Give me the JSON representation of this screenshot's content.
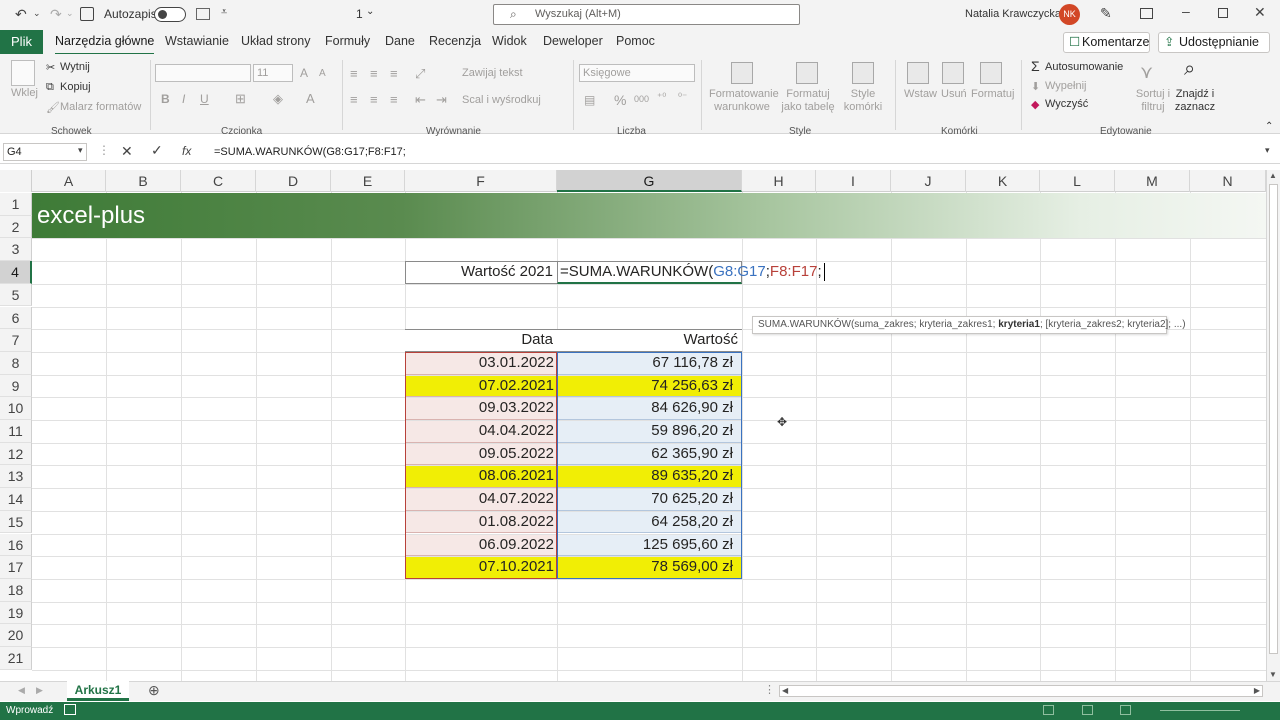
{
  "titlebar": {
    "autosave_label": "Autozapis",
    "autosave_state": "off",
    "sheet_count": "1",
    "search_placeholder": "Wyszukaj (Alt+M)",
    "user_name": "Natalia Krawczycka",
    "user_initials": "NK"
  },
  "menu": {
    "file": "Plik",
    "tabs": [
      "Narzędzia główne",
      "Wstawianie",
      "Układ strony",
      "Formuły",
      "Dane",
      "Recenzja",
      "Widok",
      "Deweloper",
      "Pomoc"
    ],
    "comments": "Komentarze",
    "share": "Udostępnianie"
  },
  "ribbon": {
    "clipboard": {
      "paste": "Wklej",
      "cut": "Wytnij",
      "copy": "Kopiuj",
      "format_painter": "Malarz formatów",
      "group": "Schowek"
    },
    "font": {
      "size": "11",
      "bold": "B",
      "italic": "I",
      "underline": "U",
      "group": "Czcionka"
    },
    "alignment": {
      "wrap": "Zawijaj tekst",
      "merge": "Scal i wyśrodkuj",
      "group": "Wyrównanie"
    },
    "number": {
      "format": "Księgowe",
      "percent": "%",
      "thousands": "000",
      "group": "Liczba"
    },
    "styles": {
      "conditional": "Formatowanie warunkowe",
      "table": "Formatuj jako tabelę",
      "cell_styles": "Style komórki",
      "group": "Style"
    },
    "cells": {
      "insert": "Wstaw",
      "delete": "Usuń",
      "format": "Formatuj",
      "group": "Komórki"
    },
    "editing": {
      "autosum": "Autosumowanie",
      "fill": "Wypełnij",
      "clear": "Wyczyść",
      "sort": "Sortuj i filtruj",
      "find": "Znajdź i zaznacz",
      "group": "Edytowanie"
    }
  },
  "formula_bar": {
    "name_box": "G4",
    "fx": "fx",
    "formula": "=SUMA.WARUNKÓW(G8:G17;F8:F17;"
  },
  "columns": [
    "A",
    "B",
    "C",
    "D",
    "E",
    "F",
    "G",
    "H",
    "I",
    "J",
    "K",
    "L",
    "M",
    "N"
  ],
  "rows": [
    "1",
    "2",
    "3",
    "4",
    "5",
    "6",
    "7",
    "8",
    "9",
    "10",
    "11",
    "12",
    "13",
    "14",
    "15",
    "16",
    "17",
    "18",
    "19",
    "20",
    "21"
  ],
  "banner": "excel-plus",
  "label_f4": "Wartość 2021",
  "edit_cell": {
    "prefix": "=SUMA.WARUNKÓW(",
    "ref1": "G8:G17",
    "sep1": ";",
    "ref2": "F8:F17",
    "sep2": ";"
  },
  "tooltip": {
    "fn": "SUMA.WARUNKÓW(suma_zakres; kryteria_zakres1; ",
    "bold": "kryteria1",
    "rest": "; [kryteria_zakres2; kryteria2]; ...)"
  },
  "table": {
    "headers": [
      "Data",
      "Wartość"
    ],
    "rows": [
      {
        "date": "03.01.2022",
        "value": "67 116,78 zł",
        "highlight": false
      },
      {
        "date": "07.02.2021",
        "value": "74 256,63 zł",
        "highlight": true
      },
      {
        "date": "09.03.2022",
        "value": "84 626,90 zł",
        "highlight": false
      },
      {
        "date": "04.04.2022",
        "value": "59 896,20 zł",
        "highlight": false
      },
      {
        "date": "09.05.2022",
        "value": "62 365,90 zł",
        "highlight": false
      },
      {
        "date": "08.06.2021",
        "value": "89 635,20 zł",
        "highlight": true
      },
      {
        "date": "04.07.2022",
        "value": "70 625,20 zł",
        "highlight": false
      },
      {
        "date": "01.08.2022",
        "value": "64 258,20 zł",
        "highlight": false
      },
      {
        "date": "06.09.2022",
        "value": "125 695,60 zł",
        "highlight": false
      },
      {
        "date": "07.10.2021",
        "value": "78 569,00 zł",
        "highlight": true
      }
    ]
  },
  "colors": {
    "excel_green": "#217346",
    "highlight_yellow": "#f1ee05",
    "date_range_fill": "#f6e8e6",
    "value_range_fill": "#e6eef6",
    "ref1_color": "#3a72c0",
    "ref2_color": "#b8413a"
  },
  "sheet_tab": "Arkusz1",
  "status": "Wprowadź"
}
